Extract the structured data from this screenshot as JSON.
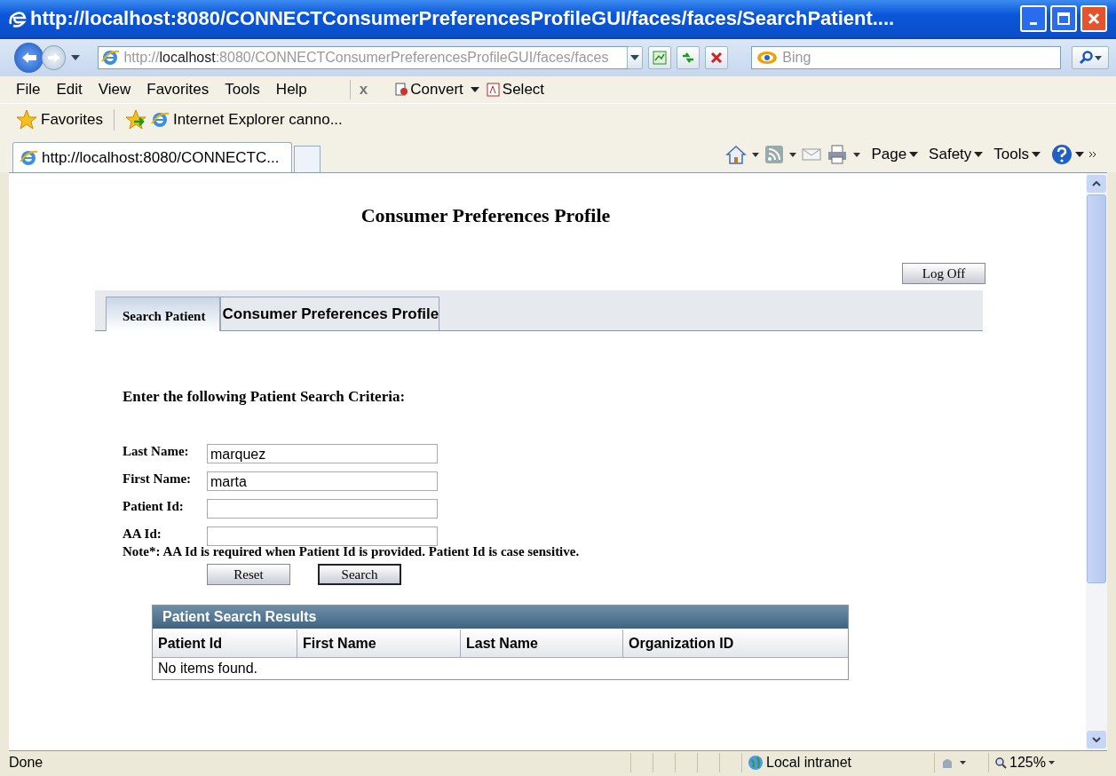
{
  "window": {
    "title": "http://localhost:8080/CONNECTConsumerPreferencesProfileGUI/faces/faces/SearchPatient...."
  },
  "address_bar": {
    "prefix": "http://",
    "host": "localhost",
    "rest": ":8080/CONNECTConsumerPreferencesProfileGUI/faces/faces"
  },
  "search": {
    "placeholder": "Bing"
  },
  "menu": [
    "File",
    "Edit",
    "View",
    "Favorites",
    "Tools",
    "Help"
  ],
  "toolbar": {
    "close": "x",
    "convert": "Convert",
    "select": "Select"
  },
  "favorites_bar": {
    "label": "Favorites",
    "item": "Internet Explorer canno..."
  },
  "browser_tabs": [
    {
      "label": "http://localhost:8080/CONNECTC...",
      "selected": true
    }
  ],
  "command_bar": [
    "Page",
    "Safety",
    "Tools"
  ],
  "page": {
    "heading": "Consumer Preferences Profile",
    "log_off": "Log Off",
    "tabs": [
      {
        "label": "Search Patient",
        "selected": true
      },
      {
        "label": "Consumer Preferences Profile",
        "selected": false
      }
    ],
    "form_heading": "Enter the following Patient Search Criteria:",
    "fields": [
      {
        "label": "Last Name:",
        "value": "marquez"
      },
      {
        "label": "First Name:",
        "value": "marta"
      },
      {
        "label": "Patient Id:"
      },
      {
        "label": "AA Id:"
      }
    ],
    "note": "Note*: AA Id is required when Patient Id is provided. Patient Id is case sensitive.",
    "buttons": [
      {
        "label": "Reset",
        "focused": false
      },
      {
        "label": "Search",
        "focused": true
      }
    ]
  },
  "results": {
    "title": "Patient Search Results",
    "columns": [
      "Patient Id",
      "First Name",
      "Last Name",
      "Organization ID"
    ],
    "empty_message": "No items found."
  },
  "status_bar": {
    "text": "Done",
    "zone": "Local intranet",
    "zoom": "125%"
  }
}
